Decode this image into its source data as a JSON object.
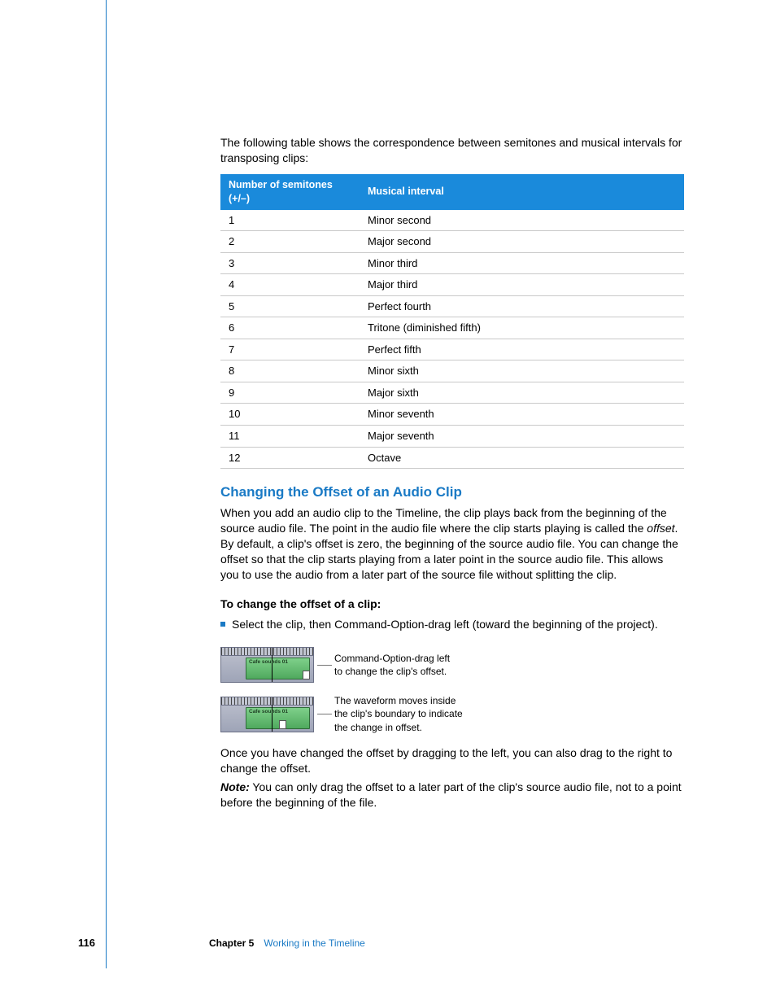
{
  "intro": "The following table shows the correspondence between semitones and musical intervals for transposing clips:",
  "table": {
    "head": [
      "Number of semitones (+/–)",
      "Musical interval"
    ],
    "rows": [
      [
        "1",
        "Minor second"
      ],
      [
        "2",
        "Major second"
      ],
      [
        "3",
        "Minor third"
      ],
      [
        "4",
        "Major third"
      ],
      [
        "5",
        "Perfect fourth"
      ],
      [
        "6",
        "Tritone (diminished fifth)"
      ],
      [
        "7",
        "Perfect fifth"
      ],
      [
        "8",
        "Minor sixth"
      ],
      [
        "9",
        "Major sixth"
      ],
      [
        "10",
        "Minor seventh"
      ],
      [
        "11",
        "Major seventh"
      ],
      [
        "12",
        "Octave"
      ]
    ]
  },
  "heading": "Changing the Offset of an Audio Clip",
  "para1a": "When you add an audio clip to the Timeline, the clip plays back from the beginning of the source audio file. The point in the audio file where the clip starts playing is called the ",
  "para1b": "offset",
  "para1c": ". By default, a clip's offset is zero, the beginning of the source audio file. You can change the offset so that the clip starts playing from a later point in the source audio file. This allows you to use the audio from a later part of the source file without splitting the clip.",
  "howto": "To change the offset of a clip:",
  "step": "Select the clip, then Command-Option-drag left (toward the beginning of the project).",
  "clipName": "Cafe sounds 01",
  "cap1a": "Command-Option-drag left",
  "cap1b": "to change the clip's offset.",
  "cap2a": "The waveform moves inside",
  "cap2b": "the clip's boundary to indicate",
  "cap2c": "the change in offset.",
  "para2": "Once you have changed the offset by dragging to the left, you can also drag to the right to change the offset.",
  "noteLabel": "Note:",
  "noteBody": "  You can only drag the offset to a later part of the clip's source audio file, not to a point before the beginning of the file.",
  "footer": {
    "page": "116",
    "chapter": "Chapter 5",
    "title": "Working in the Timeline"
  }
}
